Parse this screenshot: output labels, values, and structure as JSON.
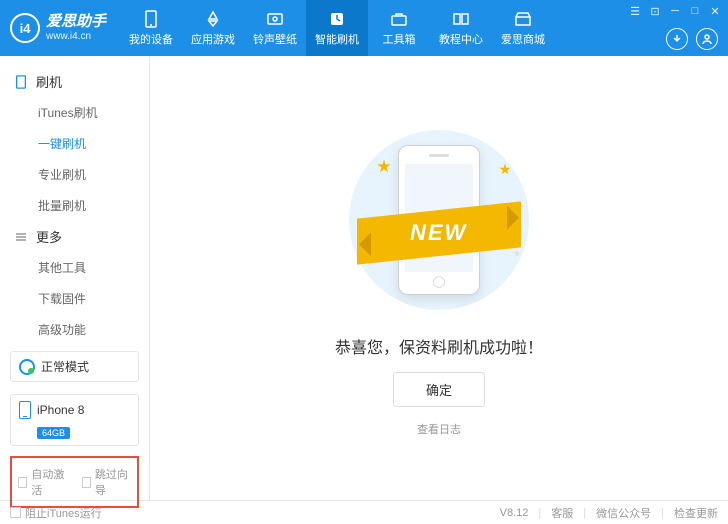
{
  "logo": {
    "badge": "i4",
    "title": "爱思助手",
    "subtitle": "www.i4.cn"
  },
  "nav": {
    "items": [
      {
        "label": "我的设备"
      },
      {
        "label": "应用游戏"
      },
      {
        "label": "铃声壁纸"
      },
      {
        "label": "智能刷机"
      },
      {
        "label": "工具箱"
      },
      {
        "label": "教程中心"
      },
      {
        "label": "爱思商城"
      }
    ]
  },
  "sidebar": {
    "group1": {
      "title": "刷机",
      "items": [
        "iTunes刷机",
        "一键刷机",
        "专业刷机",
        "批量刷机"
      ]
    },
    "group2": {
      "title": "更多",
      "items": [
        "其他工具",
        "下载固件",
        "高级功能"
      ]
    },
    "mode": "正常模式",
    "device": {
      "name": "iPhone 8",
      "storage": "64GB"
    },
    "checks": {
      "autoActivate": "自动激活",
      "skipGuide": "跳过向导"
    }
  },
  "main": {
    "ribbon": "NEW",
    "successText": "恭喜您，保资料刷机成功啦！",
    "okBtn": "确定",
    "logLink": "查看日志"
  },
  "footer": {
    "blockItunes": "阻止iTunes运行",
    "version": "V8.12",
    "support": "客服",
    "wechat": "微信公众号",
    "update": "检查更新"
  }
}
